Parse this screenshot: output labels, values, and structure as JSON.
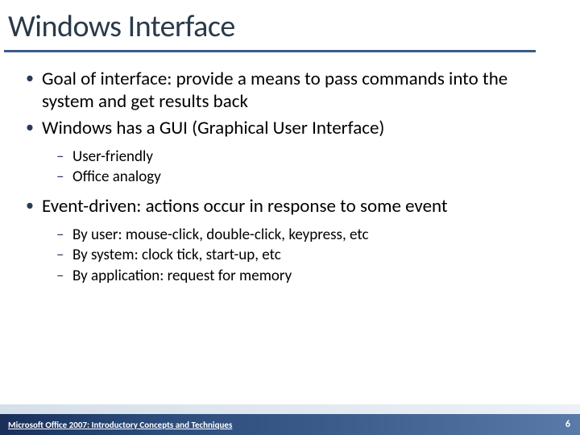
{
  "title": "Windows Interface",
  "bullets": {
    "b1": "Goal of interface:  provide a means to pass commands into the system and get results back",
    "b2": "Windows has a GUI (Graphical User Interface)",
    "b2_sub": {
      "s1": "User-friendly",
      "s2": "Office analogy"
    },
    "b3": "Event-driven:  actions occur in response to some event",
    "b3_sub": {
      "s1": "By user:  mouse-click, double-click, keypress, etc",
      "s2": "By system:  clock tick, start-up, etc",
      "s3": "By application:  request for memory"
    }
  },
  "footer": {
    "text": "Microsoft Office 2007: Introductory Concepts and Techniques",
    "page": "6"
  }
}
